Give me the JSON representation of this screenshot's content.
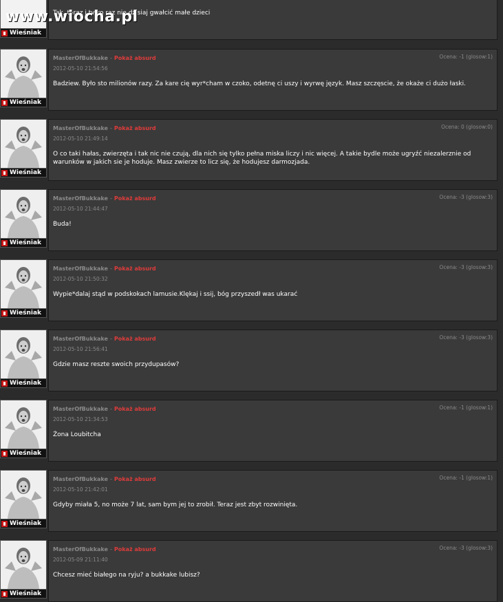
{
  "watermark": "www.wiocha.pl",
  "rank_label": "Wieśniak",
  "report_label": "Pokaż absurd",
  "top_comment": {
    "author": "",
    "date": "",
    "rating": "",
    "text": "Tak, teraz i tylko raz nie dzisiaj gwałcić małe dzieci"
  },
  "comments": [
    {
      "author": "MasterOfBukkake",
      "date": "2012-05-10 21:54:56",
      "rating": "Ocena: -1 (glosow:1)",
      "text": "Badziew. Było sto milionów razy. Za kare cię wyr*cham w czoko, odetnę ci uszy i wyrwę język. Masz szczęscie, że okaże ci dużo łaski."
    },
    {
      "author": "MasterOfBukkake",
      "date": "2012-05-10 21:49:14",
      "rating": "Ocena: 0 (glosow:0)",
      "text": "O co taki hałas, zwierzęta i tak nic nie czują, dla nich się tylko pełna miska liczy i nic więcej. A takie bydle może ugryźć niezalerznie od warunków w jakich sie je hoduje. Masz zwierze to licz się, że hodujesz darmozjada."
    },
    {
      "author": "MasterOfBukkake",
      "date": "2012-05-10 21:44:47",
      "rating": "Ocena: -3 (glosow:3)",
      "text": "Buda!"
    },
    {
      "author": "MasterOfBukkake",
      "date": "2012-05-10 21:50:32",
      "rating": "Ocena: -3 (glosow:3)",
      "text": "Wypie*dalaj stąd w podskokach lamusie.Klękaj i ssij, bóg przyszedł was ukarać"
    },
    {
      "author": "MasterOfBukkake",
      "date": "2012-05-10 21:56:41",
      "rating": "Ocena: -3 (glosow:3)",
      "text": "Gdzie masz reszte swoich przydupasów?"
    },
    {
      "author": "MasterOfBukkake",
      "date": "2012-05-10 21:34:53",
      "rating": "Ocena: -1 (glosow:1)",
      "text": "Żona Loubitcha"
    },
    {
      "author": "MasterOfBukkake",
      "date": "2012-05-10 21:42:01",
      "rating": "Ocena: -1 (glosow:1)",
      "text": "Gdyby miała 5, no może 7 lat, sam bym jej to zrobił. Teraz jest zbyt rozwinięta."
    },
    {
      "author": "MasterOfBukkake",
      "date": "2012-05-09 21:11:40",
      "rating": "Ocena: -3 (glosow:3)",
      "text": "Chcesz mieć białego na ryju? a bukkake lubisz?"
    }
  ]
}
